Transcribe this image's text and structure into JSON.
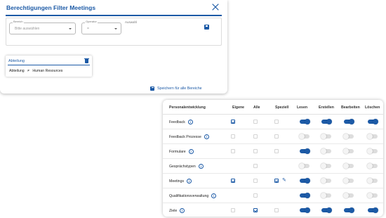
{
  "dialog": {
    "title": "Berechtigungen Filter Meetings",
    "bereich": {
      "label": "Bereich",
      "placeholder": "Bitte auswählen"
    },
    "operator": {
      "label": "Operator",
      "value": "="
    },
    "auswahl_label": "Auswahl",
    "department": {
      "title": "Abteilung",
      "field": "Abteilung",
      "operator": "≠",
      "value": "Human Resources"
    },
    "save_all_label": "Speichern für alle Bereiche"
  },
  "table": {
    "headers": [
      "Personalentwicklung",
      "Eigene",
      "Alle",
      "Speziell",
      "Lesen",
      "Erstellen",
      "Bearbeiten",
      "Löschen"
    ],
    "info_glyph": "i",
    "rows": [
      {
        "name": "Feedback",
        "eigene": true,
        "alle": false,
        "speziell": false,
        "edit": false,
        "lesen": true,
        "erstellen": true,
        "bearbeiten": true,
        "loeschen": true
      },
      {
        "name": "Feedback Prozesse",
        "eigene": false,
        "alle": false,
        "speziell": false,
        "edit": false,
        "lesen": false,
        "erstellen": false,
        "bearbeiten": false,
        "loeschen": false
      },
      {
        "name": "Formulare",
        "eigene": false,
        "alle": false,
        "speziell": false,
        "edit": false,
        "lesen": true,
        "erstellen": false,
        "bearbeiten": false,
        "loeschen": false
      },
      {
        "name": "Gesprächstypen",
        "eigene": null,
        "alle": false,
        "speziell": null,
        "edit": false,
        "lesen": false,
        "erstellen": false,
        "bearbeiten": false,
        "loeschen": false
      },
      {
        "name": "Meetings",
        "eigene": true,
        "alle": false,
        "speziell": true,
        "edit": true,
        "lesen": true,
        "erstellen": false,
        "bearbeiten": false,
        "loeschen": false
      },
      {
        "name": "Qualifikationsverwaltung",
        "eigene": null,
        "alle": false,
        "speziell": null,
        "edit": false,
        "lesen": true,
        "erstellen": false,
        "bearbeiten": false,
        "loeschen": false
      },
      {
        "name": "Ziele",
        "eigene": false,
        "alle": true,
        "speziell": false,
        "edit": false,
        "lesen": true,
        "erstellen": true,
        "bearbeiten": true,
        "loeschen": true
      }
    ]
  },
  "colors": {
    "accent": "#1c5aa6",
    "toggle_off": "#dddddd",
    "border": "#dcdcdc"
  },
  "icons": {
    "close": "close-icon",
    "save": "save-icon",
    "trash": "trash-icon",
    "info": "info-icon",
    "edit": "pencil-icon"
  }
}
